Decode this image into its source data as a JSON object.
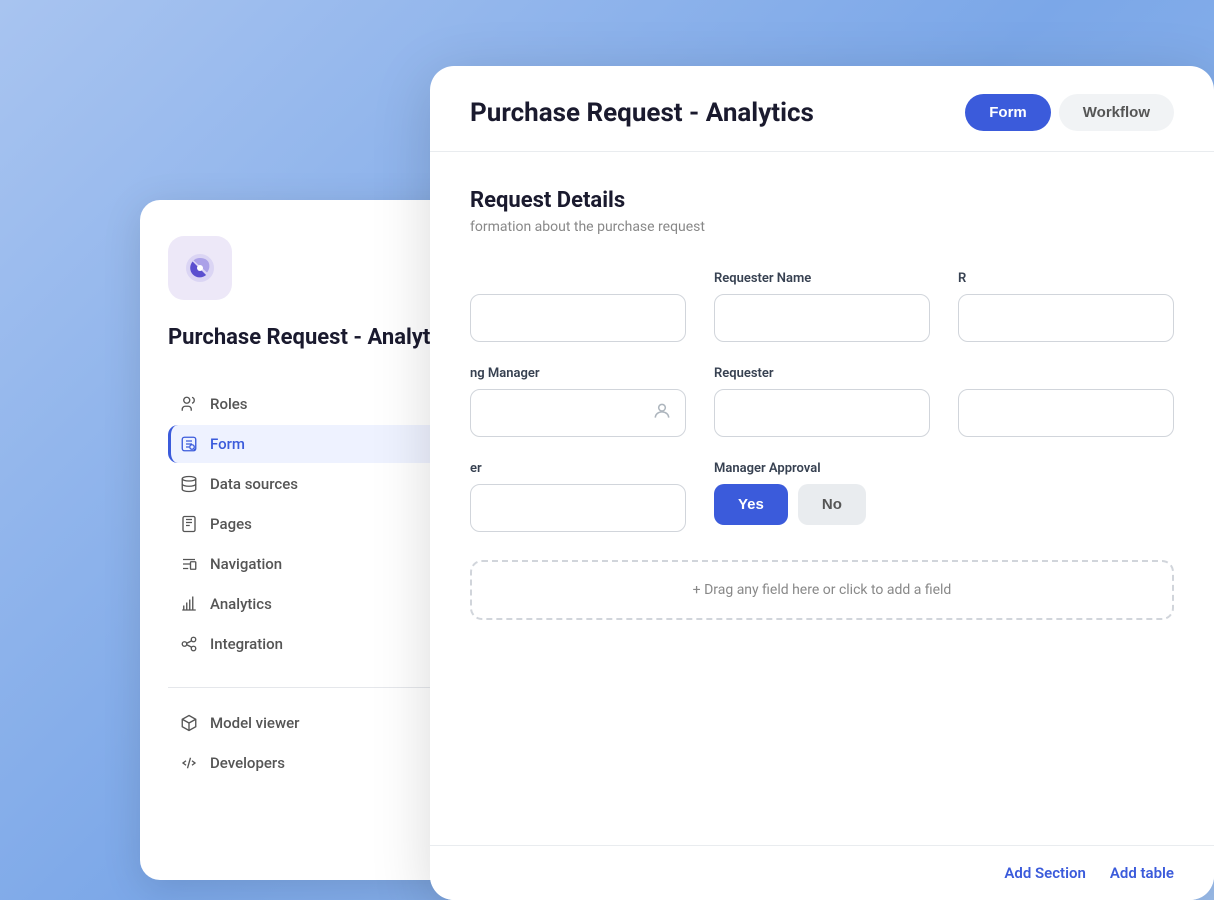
{
  "sidebar": {
    "logo_alt": "app-logo",
    "title": "Purchase Request - Analytics",
    "nav_items": [
      {
        "id": "roles",
        "label": "Roles",
        "active": false
      },
      {
        "id": "form",
        "label": "Form",
        "active": true
      },
      {
        "id": "data-sources",
        "label": "Data sources",
        "active": false
      },
      {
        "id": "pages",
        "label": "Pages",
        "active": false
      },
      {
        "id": "navigation",
        "label": "Navigation",
        "active": false
      },
      {
        "id": "analytics",
        "label": "Analytics",
        "active": false
      },
      {
        "id": "integration",
        "label": "Integration",
        "active": false
      }
    ],
    "bottom_items": [
      {
        "id": "model-viewer",
        "label": "Model viewer"
      },
      {
        "id": "developers",
        "label": "Developers"
      }
    ]
  },
  "main": {
    "title": "Purchase Request - Analytics",
    "tabs": [
      {
        "id": "form",
        "label": "Form",
        "active": true
      },
      {
        "id": "workflow",
        "label": "Workflow",
        "active": false
      }
    ],
    "section": {
      "title": "Request Details",
      "subtitle": "formation about the purchase request"
    },
    "fields": [
      {
        "id": "field1",
        "label": "",
        "placeholder": ""
      },
      {
        "id": "requester-name",
        "label": "Requester Name",
        "placeholder": ""
      },
      {
        "id": "field3",
        "label": "R",
        "placeholder": ""
      },
      {
        "id": "hiring-manager",
        "label": "ng Manager",
        "placeholder": ""
      },
      {
        "id": "requester",
        "label": "Requester",
        "placeholder": ""
      },
      {
        "id": "field6",
        "label": "",
        "placeholder": ""
      },
      {
        "id": "field7",
        "label": "er",
        "placeholder": ""
      },
      {
        "id": "manager-approval",
        "label": "Manager Approval",
        "placeholder": ""
      }
    ],
    "approval": {
      "yes_label": "Yes",
      "no_label": "No"
    },
    "drag_field_text": "+ Drag any field here or click to add a field",
    "footer": {
      "add_section": "Add Section",
      "add_table": "Add table"
    }
  }
}
